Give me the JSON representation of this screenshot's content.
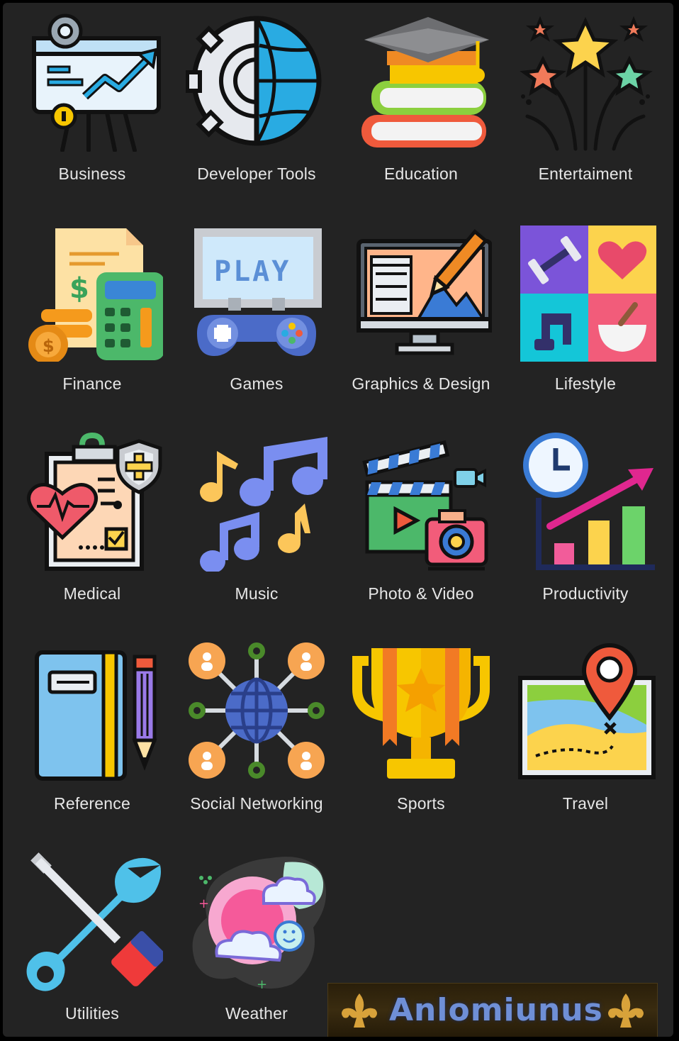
{
  "categories": [
    {
      "label": "Business",
      "icon": "business-presentation-icon"
    },
    {
      "label": "Developer Tools",
      "icon": "gear-globe-icon"
    },
    {
      "label": "Education",
      "icon": "books-graduation-cap-icon"
    },
    {
      "label": "Entertaiment",
      "icon": "fireworks-stars-icon"
    },
    {
      "label": "Finance",
      "icon": "calculator-coins-icon"
    },
    {
      "label": "Games",
      "icon": "play-screen-gamepad-icon"
    },
    {
      "label": "Graphics & Design",
      "icon": "monitor-pen-icon"
    },
    {
      "label": "Lifestyle",
      "icon": "lifestyle-tiles-icon"
    },
    {
      "label": "Medical",
      "icon": "medical-report-icon"
    },
    {
      "label": "Music",
      "icon": "music-notes-icon"
    },
    {
      "label": "Photo & Video",
      "icon": "clapper-camera-icon"
    },
    {
      "label": "Productivity",
      "icon": "clock-growth-chart-icon"
    },
    {
      "label": "Reference",
      "icon": "notebook-pencil-icon"
    },
    {
      "label": "Social Networking",
      "icon": "globe-network-icon"
    },
    {
      "label": "Sports",
      "icon": "trophy-icon"
    },
    {
      "label": "Travel",
      "icon": "map-pin-icon"
    },
    {
      "label": "Utilities",
      "icon": "wrench-screwdriver-icon"
    },
    {
      "label": "Weather",
      "icon": "sun-clouds-icon"
    }
  ],
  "watermark": {
    "text": "Anlomiunus"
  },
  "colors": {
    "background": "#232323",
    "label": "#e6e6e6",
    "outline": "#111111"
  }
}
